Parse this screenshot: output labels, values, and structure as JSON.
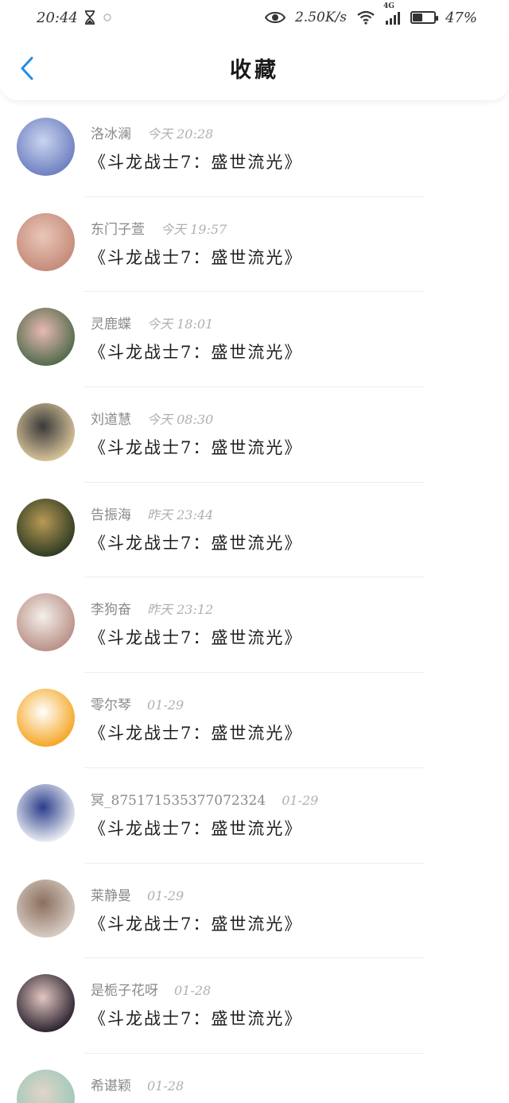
{
  "status": {
    "time": "20:44",
    "hourglass": "hourglass-icon",
    "net_speed": "2.50K/s",
    "network_tag": "4G",
    "battery_percent": "47%",
    "battery_level": 0.47
  },
  "header": {
    "title": "收藏",
    "back_icon": "chevron-left-icon",
    "accent": "#1f8ee8"
  },
  "favorites": [
    {
      "name": "洛冰澜",
      "time": "今天 20:28",
      "book": "《斗龙战士7：盛世流光》",
      "avatar_colors": [
        "#6d7fbf",
        "#c9d4f0"
      ]
    },
    {
      "name": "东门子萱",
      "time": "今天 19:57",
      "book": "《斗龙战士7：盛世流光》",
      "avatar_colors": [
        "#c58a78",
        "#e9c7b9"
      ]
    },
    {
      "name": "灵鹿蝶",
      "time": "今天 18:01",
      "book": "《斗龙战士7：盛世流光》",
      "avatar_colors": [
        "#4f6a4a",
        "#e8b9b2"
      ]
    },
    {
      "name": "刘道慧",
      "time": "今天 08:30",
      "book": "《斗龙战士7：盛世流光》",
      "avatar_colors": [
        "#d9c59a",
        "#3a3a3a"
      ]
    },
    {
      "name": "告振海",
      "time": "昨天 23:44",
      "book": "《斗龙战士7：盛世流光》",
      "avatar_colors": [
        "#2e3a22",
        "#b89a55"
      ]
    },
    {
      "name": "李狗奋",
      "time": "昨天 23:12",
      "book": "《斗龙战士7：盛世流光》",
      "avatar_colors": [
        "#b98f86",
        "#f4f0ea"
      ]
    },
    {
      "name": "零尔琴",
      "time": "01-29",
      "book": "《斗龙战士7：盛世流光》",
      "avatar_colors": [
        "#f5a623",
        "#ffffff"
      ]
    },
    {
      "name": "冥_875171535377072324",
      "time": "01-29",
      "book": "《斗龙战士7：盛世流光》",
      "avatar_colors": [
        "#eef0f4",
        "#2b3e8c"
      ]
    },
    {
      "name": "莱静曼",
      "time": "01-29",
      "book": "《斗龙战士7：盛世流光》",
      "avatar_colors": [
        "#d8cdc4",
        "#8b6f5e"
      ]
    },
    {
      "name": "是栀子花呀",
      "time": "01-28",
      "book": "《斗龙战士7：盛世流光》",
      "avatar_colors": [
        "#2a2230",
        "#e3c7c0"
      ]
    },
    {
      "name": "希谌颖",
      "time": "01-28",
      "book": "",
      "avatar_colors": [
        "#9cc8b8",
        "#e0d5c8"
      ]
    }
  ]
}
